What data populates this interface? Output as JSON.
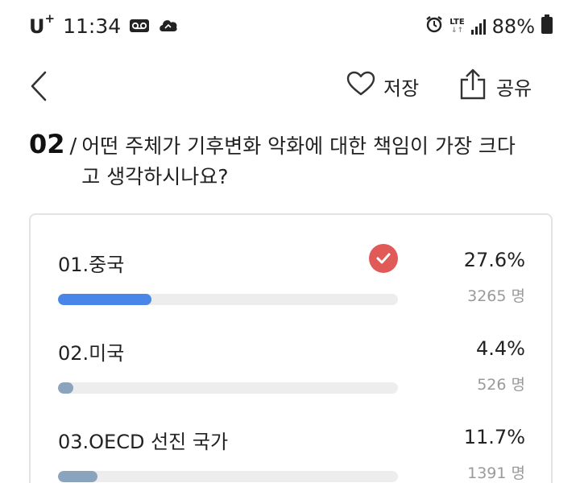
{
  "status_bar": {
    "carrier": "U",
    "carrier_plus": "+",
    "time": "11:34",
    "lte": "LTE",
    "lte_arrows": "↓↑",
    "battery": "88%"
  },
  "nav": {
    "save_label": "저장",
    "share_label": "공유"
  },
  "question": {
    "number": "02",
    "separator": "/",
    "text": "어떤 주체가 기후변화 악화에 대한 책임이 가장 크다고 생각하시나요?"
  },
  "options": [
    {
      "label": "01.중국",
      "percent": "27.6%",
      "count": "3265 명",
      "fill": 0.276,
      "color": "#4a86e8",
      "selected": true
    },
    {
      "label": "02.미국",
      "percent": "4.4%",
      "count": "526 명",
      "fill": 0.044,
      "color": "#8aa4bd",
      "selected": false
    },
    {
      "label": "03.OECD 선진 국가",
      "percent": "11.7%",
      "count": "1391 명",
      "fill": 0.117,
      "color": "#8aa4bd",
      "selected": false
    }
  ],
  "colors": {
    "accent": "#4a86e8",
    "muted_bar": "#8aa4bd",
    "check": "#e05a58"
  },
  "icons": [
    "back-icon",
    "heart-icon",
    "share-icon",
    "check-icon",
    "voicemail-icon",
    "cloud-icon",
    "alarm-icon",
    "signal-icon",
    "battery-icon"
  ]
}
